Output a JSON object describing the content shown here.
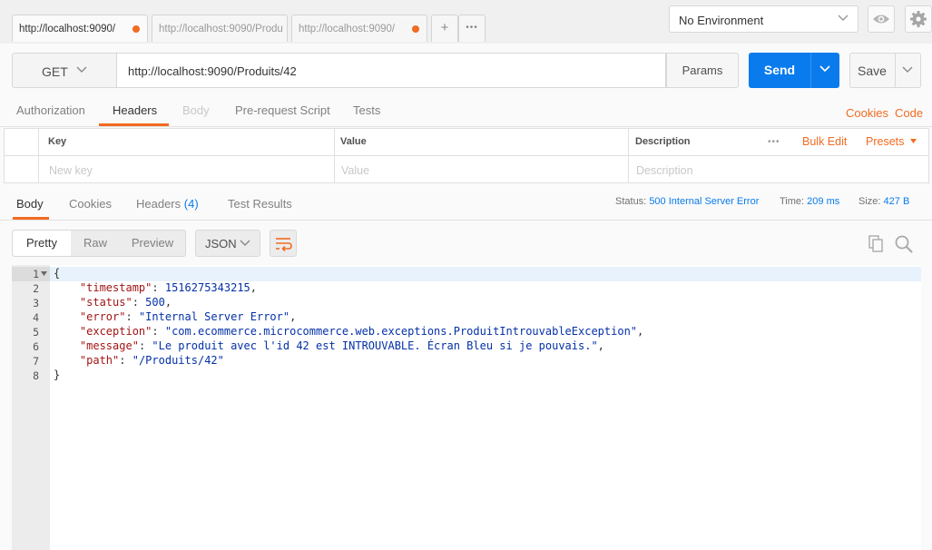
{
  "tabs": [
    {
      "label": "http://localhost:9090/",
      "unsaved": true
    },
    {
      "label": "http://localhost:9090/Produ",
      "unsaved": false
    },
    {
      "label": "http://localhost:9090/",
      "unsaved": true
    }
  ],
  "tab_actions": {
    "add": "+",
    "more": "•••"
  },
  "environment": {
    "selected": "No Environment"
  },
  "request": {
    "method": "GET",
    "url": "http://localhost:9090/Produits/42",
    "params_label": "Params",
    "send_label": "Send",
    "save_label": "Save"
  },
  "request_tabs": [
    "Authorization",
    "Headers",
    "Body",
    "Pre-request Script",
    "Tests"
  ],
  "request_links": {
    "cookies": "Cookies",
    "code": "Code"
  },
  "headers_table": {
    "columns": [
      "Key",
      "Value",
      "Description"
    ],
    "placeholders": [
      "New key",
      "Value",
      "Description"
    ],
    "more": "•••",
    "bulk_edit": "Bulk Edit",
    "presets": "Presets"
  },
  "response_tabs": {
    "body": "Body",
    "cookies": "Cookies",
    "headers": "Headers",
    "headers_count": "(4)",
    "test_results": "Test Results"
  },
  "response_status": {
    "status_label": "Status:",
    "status_value": "500 Internal Server Error",
    "time_label": "Time:",
    "time_value": "209 ms",
    "size_label": "Size:",
    "size_value": "427 B"
  },
  "response_view": {
    "modes": [
      "Pretty",
      "Raw",
      "Preview"
    ],
    "active_mode": "Pretty",
    "format": "JSON"
  },
  "response_body": {
    "open": "{",
    "close": "}",
    "fields": [
      {
        "key": "\"timestamp\"",
        "value": "1516275343215",
        "kind": "number",
        "comma": ","
      },
      {
        "key": "\"status\"",
        "value": "500",
        "kind": "number",
        "comma": ","
      },
      {
        "key": "\"error\"",
        "value": "\"Internal Server Error\"",
        "kind": "string",
        "comma": ","
      },
      {
        "key": "\"exception\"",
        "value": "\"com.ecommerce.microcommerce.web.exceptions.ProduitIntrouvableException\"",
        "kind": "string",
        "comma": ","
      },
      {
        "key": "\"message\"",
        "value": "\"Le produit avec l'id 42 est INTROUVABLE. Écran Bleu si je pouvais.\"",
        "kind": "string",
        "comma": ","
      },
      {
        "key": "\"path\"",
        "value": "\"/Produits/42\"",
        "kind": "string",
        "comma": ""
      }
    ],
    "line_numbers": [
      "1",
      "2",
      "3",
      "4",
      "5",
      "6",
      "7",
      "8"
    ]
  },
  "colors": {
    "accent_orange": "#f26b21",
    "send_blue": "#097bed",
    "status_blue": "#097bed"
  },
  "icons": [
    "eye-icon",
    "gear-icon",
    "chevron-down-icon",
    "wrap-lines-icon",
    "copy-icon",
    "search-icon",
    "caret-down-icon"
  ]
}
